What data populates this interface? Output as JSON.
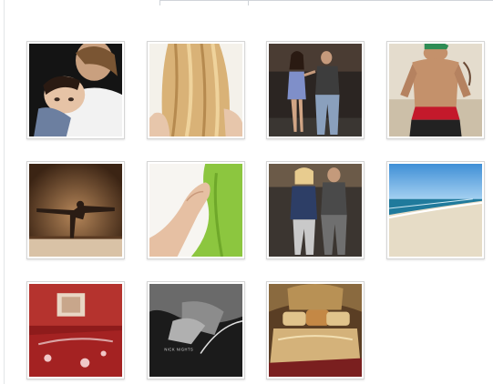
{
  "gallery": {
    "photos": [
      {
        "name": "mother-and-baby-photo"
      },
      {
        "name": "blonde-hair-back-photo"
      },
      {
        "name": "couple-walking-street-photo"
      },
      {
        "name": "shirtless-man-photo"
      },
      {
        "name": "yoga-pose-photo"
      },
      {
        "name": "hand-green-towel-photo"
      },
      {
        "name": "couple-holding-hands-photo"
      },
      {
        "name": "beach-shoreline-photo"
      },
      {
        "name": "red-bedroom-photo"
      },
      {
        "name": "black-and-white-embrace-photo",
        "caption": "NICK NIGHTS"
      },
      {
        "name": "luxury-bedding-photo"
      }
    ]
  }
}
